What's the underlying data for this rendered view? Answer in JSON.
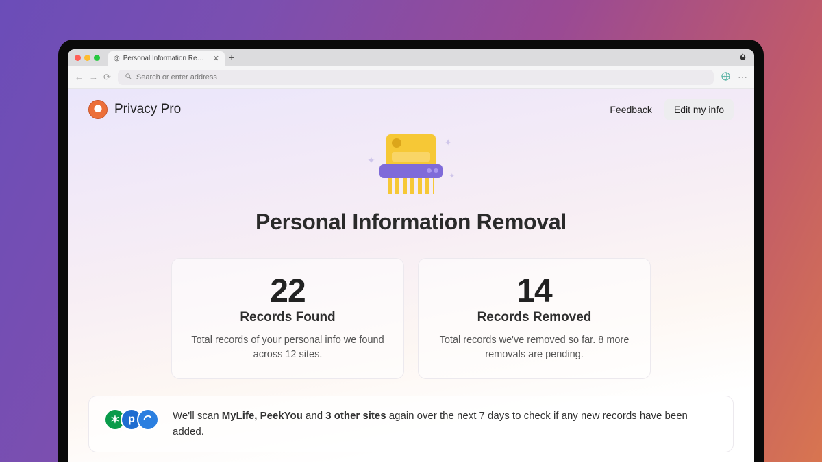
{
  "browser": {
    "tab_title": "Personal Information Removal",
    "address_placeholder": "Search or enter address"
  },
  "appbar": {
    "brand": "Privacy Pro",
    "feedback": "Feedback",
    "edit_button": "Edit my info"
  },
  "hero": {
    "title": "Personal Information Removal"
  },
  "stats": {
    "found": {
      "value": "22",
      "label": "Records Found",
      "description": "Total records of your personal info we found across 12 sites."
    },
    "removed": {
      "value": "14",
      "label": "Records Removed",
      "description": "Total records we've removed so far. 8 more removals are pending."
    }
  },
  "scan": {
    "prefix": "We'll scan ",
    "sites_bold": "MyLife, PeekYou",
    "mid": " and ",
    "more_bold": "3 other sites",
    "suffix": " again over the next 7 days to check if any new records have been added."
  }
}
